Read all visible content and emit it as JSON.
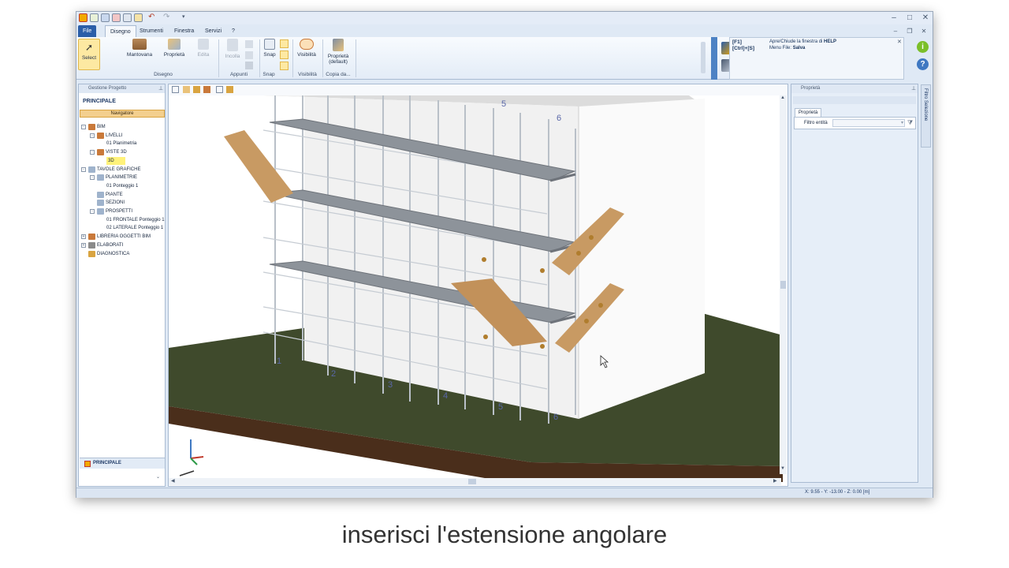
{
  "app": {
    "tabs": [
      "File",
      "Disegno",
      "Strumenti",
      "Finestra",
      "Servizi",
      "?"
    ],
    "active_tab": "Disegno"
  },
  "ribbon": {
    "select": "Select",
    "mantovana": "Mantovana",
    "proprieta": "Proprietà",
    "edita": "Edita",
    "group_disegno": "Disegno",
    "incolla": "Incolla",
    "group_appunti": "Appunti",
    "snap": "Snap",
    "group_snap": "Snap",
    "visibilita": "Visibilità",
    "group_visibilita": "Visibilità",
    "prop_default_1": "Proprietà",
    "prop_default_2": "(default)",
    "group_copia": "Copia da..."
  },
  "help": {
    "key1": "[F1]",
    "text1a": "Apre/Chiude la finestra di ",
    "text1b": "HELP",
    "key2": "[Ctrl]+[S]",
    "text2a": "Menu File: ",
    "text2b": "Salva"
  },
  "left_panel": {
    "header": "Gestione Progetto",
    "title": "PRINCIPALE",
    "navigator": "Navigatore",
    "tree": [
      {
        "label": "BIM",
        "level": 0,
        "box": "-",
        "icon": "#c9793a"
      },
      {
        "label": "LIVELLI",
        "level": 1,
        "box": "-",
        "icon": "#c9793a"
      },
      {
        "label": "01 Planimetria",
        "level": 2,
        "box": "",
        "icon": ""
      },
      {
        "label": "VISTE 3D",
        "level": 1,
        "box": "-",
        "icon": "#c9793a"
      },
      {
        "label": "3D",
        "level": 2,
        "box": "",
        "icon": "",
        "selected": true
      },
      {
        "label": "TAVOLE GRAFICHE",
        "level": 0,
        "box": "-",
        "icon": "#9fb3cc"
      },
      {
        "label": "PLANIMETRIE",
        "level": 1,
        "box": "-",
        "icon": "#9fb3cc"
      },
      {
        "label": "01 Ponteggio 1",
        "level": 2,
        "box": "",
        "icon": ""
      },
      {
        "label": "PIANTE",
        "level": 1,
        "box": "",
        "icon": "#9fb3cc"
      },
      {
        "label": "SEZIONI",
        "level": 1,
        "box": "",
        "icon": "#9fb3cc"
      },
      {
        "label": "PROSPETTI",
        "level": 1,
        "box": "-",
        "icon": "#9fb3cc"
      },
      {
        "label": "01 FRONTALE Ponteggio 1",
        "level": 2,
        "box": "",
        "icon": ""
      },
      {
        "label": "02 LATERALE Ponteggio 1",
        "level": 2,
        "box": "",
        "icon": ""
      },
      {
        "label": "LIBRERIA OGGETTI BIM",
        "level": 0,
        "box": "+",
        "icon": "#c9793a"
      },
      {
        "label": "ELABORATI",
        "level": 0,
        "box": "+",
        "icon": "#8a8a8a"
      },
      {
        "label": "DIAGNOSTICA",
        "level": 0,
        "box": "",
        "icon": "#d9a441"
      }
    ],
    "footer": "PRINCIPALE"
  },
  "right_panel": {
    "header": "Proprietà",
    "tab": "Proprietà",
    "filter_label": "Filtro entità",
    "side_tab": "Filtro Selezione"
  },
  "viewport": {
    "labels_top": [
      "5",
      "6"
    ],
    "labels_bottom": [
      "1",
      "2",
      "3",
      "4",
      "5",
      "6"
    ]
  },
  "status": {
    "coords": "X: 9.55 - Y: -13.00 - Z: 0.00 [m]"
  },
  "caption": "inserisci l'estensione angolare"
}
